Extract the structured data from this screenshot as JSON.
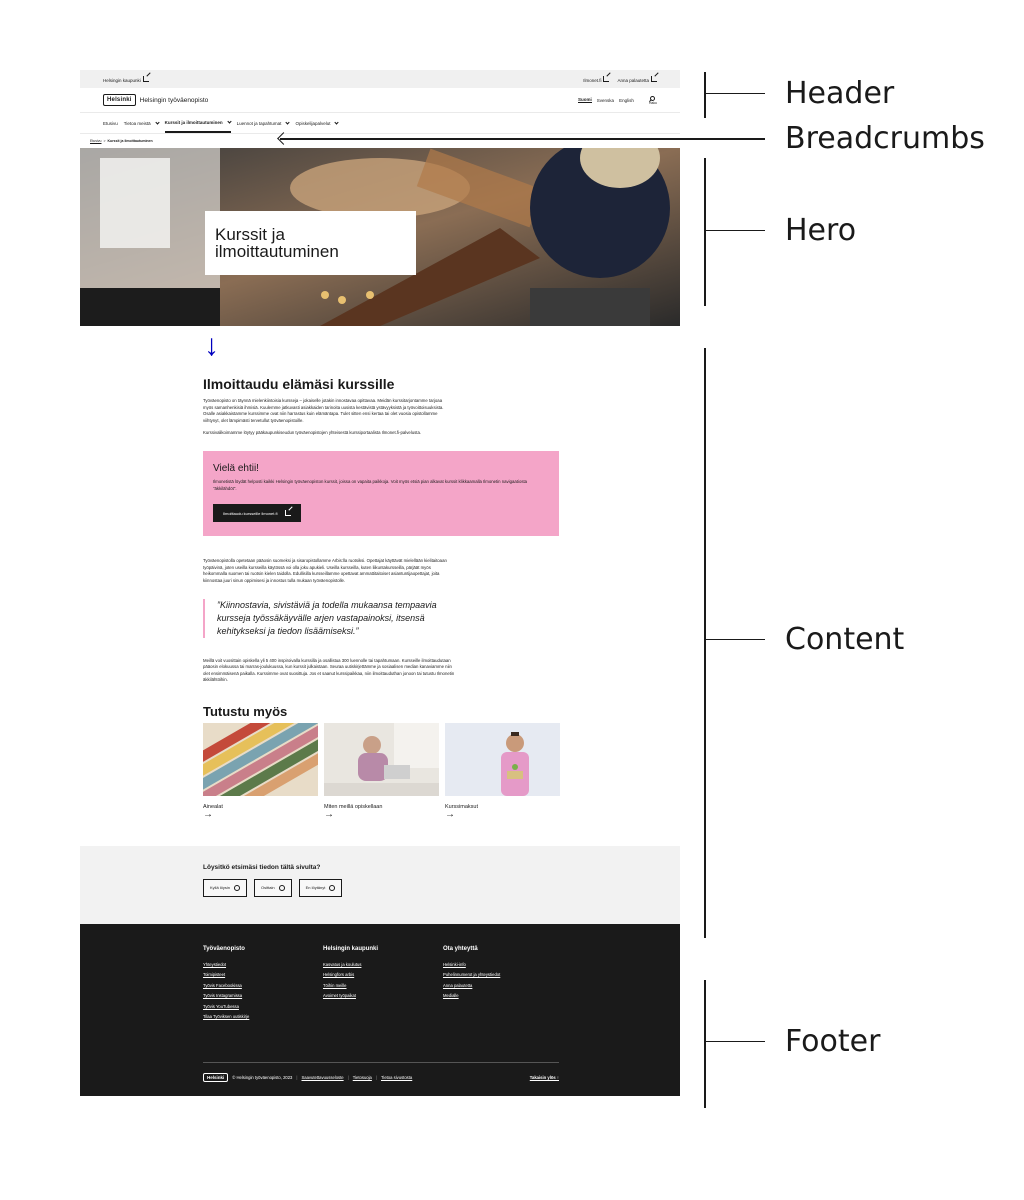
{
  "header": {
    "top_left": "Helsingin kaupunki",
    "top_right": [
      "Ilmonet.fi",
      "Anna palautetta"
    ],
    "logo": "Helsinki",
    "site_name": "Helsingin työväenopisto",
    "languages": [
      "Suomi",
      "Svenska",
      "English"
    ],
    "search_label": "Haku"
  },
  "nav": {
    "items": [
      "Etusivu",
      "Tietoa meistä",
      "Kurssit ja ilmoittautuminen",
      "Luennot ja tapahtumat",
      "Opiskelijapalvelut"
    ],
    "active": "Kurssit ja ilmoittautuminen"
  },
  "breadcrumbs": {
    "home": "Etusivu",
    "separator": ">",
    "current": "Kurssit ja ilmoittautuminen"
  },
  "hero": {
    "title": "Kurssit ja ilmoittautuminen",
    "arrow": "↓"
  },
  "content": {
    "heading": "Ilmoittaudu elämäsi kurssille",
    "intro": "Työväenopisto on täynnä mielenkiintoisia kursseja – jokaiselle jotakin innostavaa opittavaa. Meidän kurssitarjontamme tarjoaa myös samanhenkisiä ihmisiä. Kuulemme jatkuvasti asiakkaiden tarinoita uusista kestävistä ystävyyksistä ja työvoittoisuuksista. Osalle asiakkaistamme kurssimme ovat niin harrastus kuin elämäntapa. Tulet sitten ensi kertaa tai olet vuosia opistollamme viihtynyt, olet lämpimästi tervetullut työväenopistoille.",
    "intro2": "Kurssivalikoimamme löytyy pääkaupunkiseudun työväenopistojen yhteisestä kurssiportaalista Ilmonet.fi-palvelusta.",
    "highlight_title": "Vielä ehtii!",
    "highlight_text": "Ilmonetistä löydät helposti kaikki Helsingin työväenopiston kurssit, joissa on vapaita paikkoja. Voit myös etsiä pian alkavat kurssit klikkaamalla Ilmonetin navigaatiosta \"äkkilähdöt\".",
    "cta_label": "Ilmoittaudu kursseille ilmonet.fi",
    "para2": "Työväenopistolla opetetaan pääosin suomeksi ja sisaropistollamme Arbis:lla ruotsiksi. Opettajat käyttävät mielellään kielitaitoaan työpäivinä, joten useilla kursseilla käytössä voi olla joku apukieli. Useilla kursseilla, kuten liikuntakursseilla, pärjäät myös heikommalla suomen tai ruotsin kielen taidolla. Edullisilla kursseillamme opettavat ammattitaitoiset asiantuntijaopettajat, joita kiinnostaa juuri sinun oppimisesi ja innostus tulla mukaan työväenopistolle.",
    "quote": "”Kiinnostavia, sivistäviä ja todella mukaansa tempaavia kursseja työssäkäyvälle arjen vastapainoksi, itsensä kehitykseksi ja tiedon lisäämiseksi.”",
    "para3": "Meillä voit vuosittain opiskella yli 5 400 inspiroivalla kurssilla ja osallistua 300 luennolle tai tapahtumaan. Kursseille ilmoittaudutaan pääosin elokuussa tai marras-joulukuussa, kun kurssit julkaistaan. Seuraa uutiskirjettämme ja sosiaalisen median kanaviamme niin olet ensimmäisenä paikalla. Kurssimme ovat suosittuja. Jos et saanut kurssipaikkaa, niin ilmoittauduthan jonoon tai tutustu Ilmonetin äkkilähtöihin.",
    "explore_heading": "Tutustu myös",
    "cards": [
      {
        "label": "Ainealat",
        "arrow": "→"
      },
      {
        "label": "Miten meillä opiskellaan",
        "arrow": "→"
      },
      {
        "label": "Kurssimaksut",
        "arrow": "→"
      }
    ]
  },
  "feedback": {
    "question": "Löysitkö etsimäsi tiedon tältä sivulta?",
    "buttons": [
      "Kyllä löysin",
      "Osittain",
      "En löytänyt"
    ]
  },
  "footer": {
    "columns": [
      {
        "title": "Työväenopisto",
        "links": [
          "Yhteystiedot",
          "Toimipisteet",
          "Työvis Facebookissa",
          "Työvis Instagramissa",
          "Työvis YouTubessa",
          "Tilaa Työviksen uutiskirje"
        ]
      },
      {
        "title": "Helsingin kaupunki",
        "links": [
          "Kasvatus ja koulutus",
          "Helsingfors arbis",
          "Töihin meille",
          "Avoimet työpaikat"
        ]
      },
      {
        "title": "Ota yhteyttä",
        "links": [
          "Helsinki-info",
          "Puhelinnumerot ja yhteystiedot",
          "Anna palautetta",
          "Medialle"
        ]
      }
    ],
    "logo": "Helsinki",
    "copyright": "© Helsingin työväenopisto, 2023",
    "bottom_links": [
      "Saavutettavuusseloste",
      "Tietosuoja",
      "Tietoa sivustosta"
    ],
    "back_to_top": "Takaisin ylös ↑"
  },
  "annotations": [
    "Header",
    "Breadcrumbs",
    "Hero",
    "Content",
    "Footer"
  ]
}
